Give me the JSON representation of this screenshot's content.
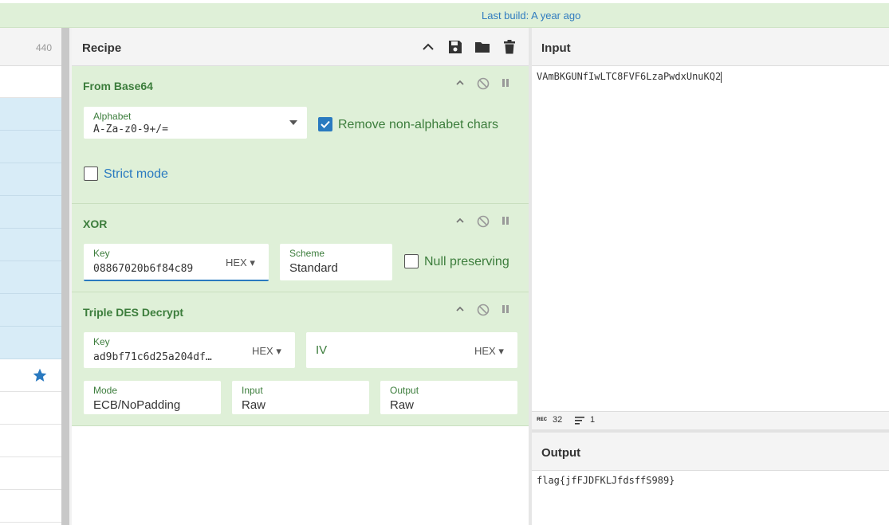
{
  "banner": {
    "text": "Last build: A year ago"
  },
  "operations": {
    "count": "440"
  },
  "recipe": {
    "title": "Recipe",
    "ops": [
      {
        "name": "From Base64",
        "alphabet_label": "Alphabet",
        "alphabet_value": "A-Za-z0-9+/=",
        "remove_label": "Remove non-alphabet chars",
        "remove_checked": true,
        "strict_label": "Strict mode",
        "strict_checked": false
      },
      {
        "name": "XOR",
        "key_label": "Key",
        "key_value": "08867020b6f84c89",
        "key_format": "HEX",
        "scheme_label": "Scheme",
        "scheme_value": "Standard",
        "null_label": "Null preserving",
        "null_checked": false
      },
      {
        "name": "Triple DES Decrypt",
        "key_label": "Key",
        "key_value": "ad9bf71c6d25a204df…",
        "key_format": "HEX",
        "iv_label": "IV",
        "iv_format": "HEX",
        "mode_label": "Mode",
        "mode_value": "ECB/NoPadding",
        "input_label": "Input",
        "input_value": "Raw",
        "output_label": "Output",
        "output_value": "Raw"
      }
    ]
  },
  "input": {
    "title": "Input",
    "text": "VAmBKGUNfIwLTC8FVF6LzaPwdxUnuKQ2",
    "length": "32",
    "lines": "1",
    "length_icon": "rec-icon"
  },
  "output": {
    "title": "Output",
    "text": "flag{jfFJDFKLJfdsffS989}"
  },
  "colors": {
    "op_bg": "#dff0d8",
    "op_name": "#3c7d3c",
    "accent": "#2a7ac0",
    "star": "#2a7ac0"
  }
}
